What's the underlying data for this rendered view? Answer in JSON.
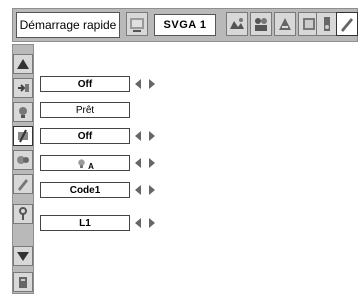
{
  "header": {
    "menu_title": "Démarrage rapide",
    "mode_label": "SVGA 1"
  },
  "top_icons": [
    "quick-start-icon",
    "pc-adjust-icon",
    "image-select-icon",
    "image-adjust-icon",
    "screen-icon",
    "sound-icon",
    "setting-icon"
  ],
  "side_icons": [
    "up-arrow-icon",
    "input-icon",
    "lamp-icon",
    "setting-icon",
    "expand-icon",
    "pc-system-icon",
    "key-icon",
    "down-arrow-icon",
    "info-icon"
  ],
  "settings": [
    {
      "value": "Off",
      "has_arrows": true
    },
    {
      "value": "Prêt",
      "has_arrows": false
    },
    {
      "value": "Off",
      "has_arrows": true
    },
    {
      "value": "A",
      "has_arrows": true
    },
    {
      "value": "Code1",
      "has_arrows": true
    },
    {
      "value": "L1",
      "has_arrows": true
    }
  ],
  "colors": {
    "menu_gray": "#b9b9b9",
    "icon_gray": "#d8d8d8",
    "arrow_gray": "#666666"
  }
}
